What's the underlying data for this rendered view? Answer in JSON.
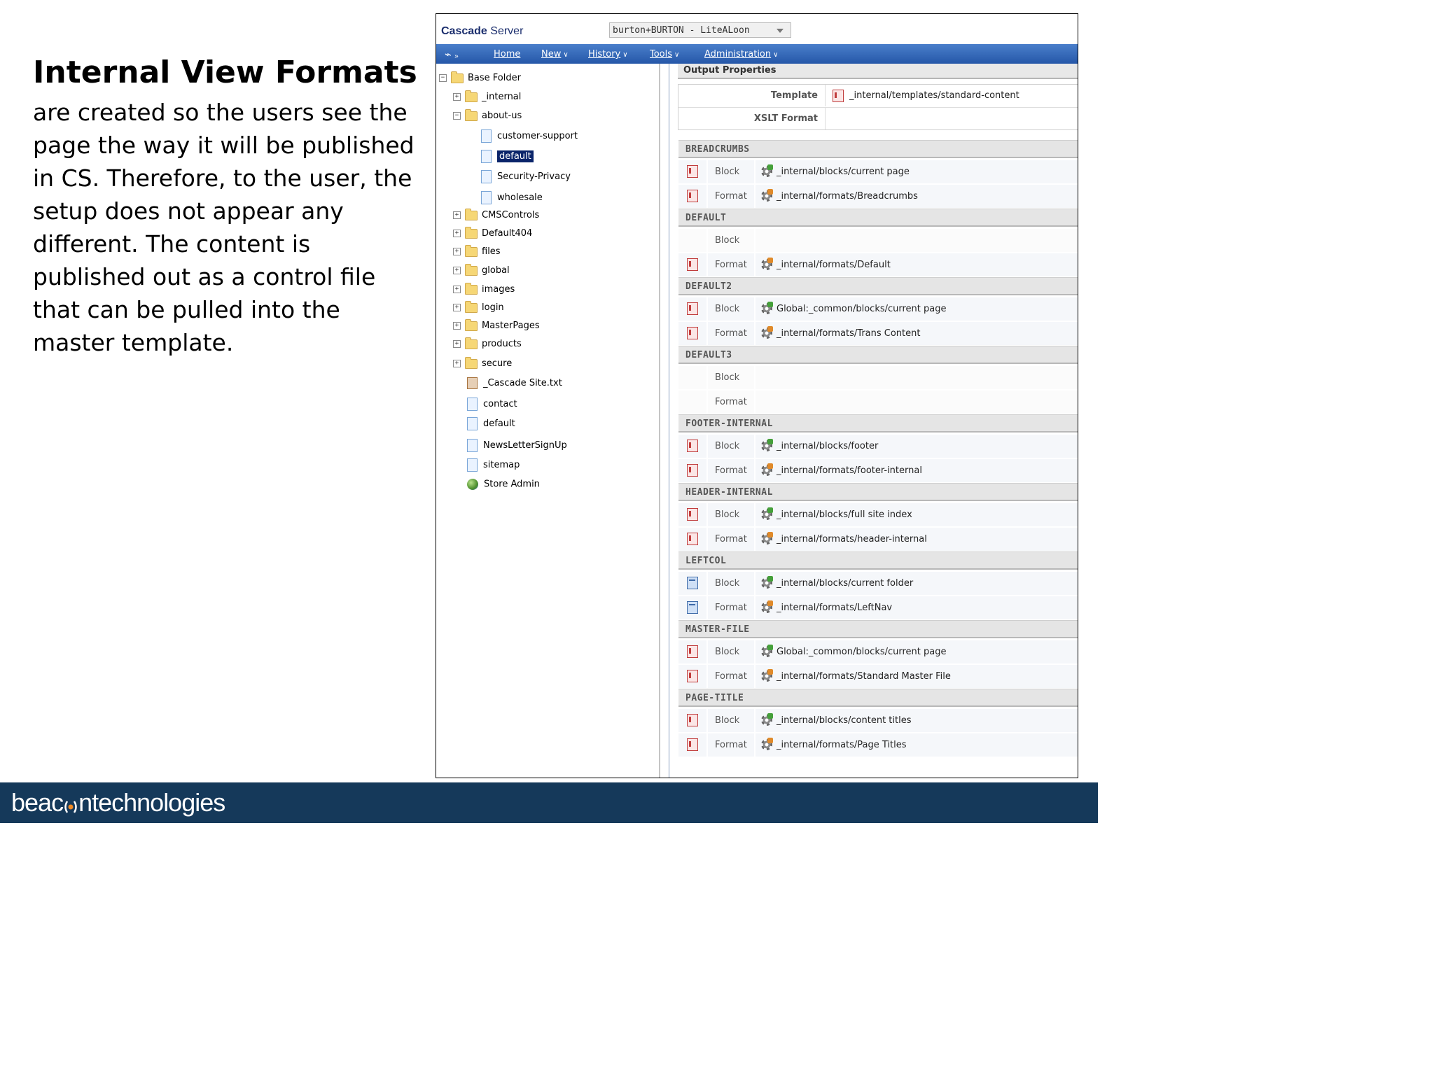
{
  "slide": {
    "title": "Internal View Formats",
    "body_lines": [
      "are created so the users see the",
      "page the way it will be published",
      "in CS.  Therefore, to the user, the",
      "setup does not appear any",
      "different.  The content is",
      "published out as a control file",
      "that can be pulled into the",
      "master template."
    ]
  },
  "footer": {
    "brand_left": "beac",
    "brand_right": "ntechnologies"
  },
  "app": {
    "logo_bold": "Cascade",
    "logo_rest": " Server",
    "site_selector": "burton+BURTON - LiteALoon",
    "menu": [
      "Home",
      "New",
      "History",
      "Tools",
      "Administration"
    ]
  },
  "tree": {
    "root": "Base Folder",
    "items": [
      {
        "label": "_internal",
        "kind": "folder",
        "toggle": "+"
      },
      {
        "label": "about-us",
        "kind": "folder",
        "toggle": "-"
      },
      {
        "label": "customer-support",
        "kind": "page"
      },
      {
        "label": "default",
        "kind": "page",
        "selected": true
      },
      {
        "label": "Security-Privacy",
        "kind": "page"
      },
      {
        "label": "wholesale",
        "kind": "page"
      },
      {
        "label": "CMSControls",
        "kind": "folder",
        "toggle": "+"
      },
      {
        "label": "Default404",
        "kind": "folder",
        "toggle": "+"
      },
      {
        "label": "files",
        "kind": "folder",
        "toggle": "+"
      },
      {
        "label": "global",
        "kind": "folder",
        "toggle": "+"
      },
      {
        "label": "images",
        "kind": "folder",
        "toggle": "+"
      },
      {
        "label": "login",
        "kind": "folder",
        "toggle": "+"
      },
      {
        "label": "MasterPages",
        "kind": "folder",
        "toggle": "+"
      },
      {
        "label": "products",
        "kind": "folder",
        "toggle": "+"
      },
      {
        "label": "secure",
        "kind": "folder",
        "toggle": "+"
      },
      {
        "label": "_Cascade Site.txt",
        "kind": "file"
      },
      {
        "label": "contact",
        "kind": "page"
      },
      {
        "label": "default",
        "kind": "page"
      },
      {
        "label": "NewsLetterSignUp",
        "kind": "page"
      },
      {
        "label": "sitemap",
        "kind": "page"
      },
      {
        "label": "Store Admin",
        "kind": "globe"
      }
    ]
  },
  "output_properties": {
    "title": "Output Properties",
    "template_label": "Template",
    "template_value": "_internal/templates/standard-content",
    "xslt_label": "XSLT Format",
    "xslt_value": ""
  },
  "regions": [
    {
      "name": "BREADCRUMBS",
      "rows": [
        {
          "type": "Block",
          "path": "_internal/blocks/current page",
          "icon": "red"
        },
        {
          "type": "Format",
          "path": "_internal/formats/Breadcrumbs",
          "icon": "red"
        }
      ]
    },
    {
      "name": "DEFAULT",
      "rows": [
        {
          "type": "Block",
          "path": "",
          "icon": ""
        },
        {
          "type": "Format",
          "path": "_internal/formats/Default",
          "icon": "red"
        }
      ]
    },
    {
      "name": "DEFAULT2",
      "rows": [
        {
          "type": "Block",
          "path": "Global:_common/blocks/current page",
          "icon": "red"
        },
        {
          "type": "Format",
          "path": "_internal/formats/Trans Content",
          "icon": "red"
        }
      ]
    },
    {
      "name": "DEFAULT3",
      "rows": [
        {
          "type": "Block",
          "path": "",
          "icon": ""
        },
        {
          "type": "Format",
          "path": "",
          "icon": ""
        }
      ]
    },
    {
      "name": "FOOTER-INTERNAL",
      "rows": [
        {
          "type": "Block",
          "path": "_internal/blocks/footer",
          "icon": "red"
        },
        {
          "type": "Format",
          "path": "_internal/formats/footer-internal",
          "icon": "red"
        }
      ]
    },
    {
      "name": "HEADER-INTERNAL",
      "rows": [
        {
          "type": "Block",
          "path": "_internal/blocks/full site index",
          "icon": "red"
        },
        {
          "type": "Format",
          "path": "_internal/formats/header-internal",
          "icon": "red"
        }
      ]
    },
    {
      "name": "LEFTCOL",
      "rows": [
        {
          "type": "Block",
          "path": "_internal/blocks/current folder",
          "icon": "blue"
        },
        {
          "type": "Format",
          "path": "_internal/formats/LeftNav",
          "icon": "blue"
        }
      ]
    },
    {
      "name": "MASTER-FILE",
      "rows": [
        {
          "type": "Block",
          "path": "Global:_common/blocks/current page",
          "icon": "red"
        },
        {
          "type": "Format",
          "path": "_internal/formats/Standard Master File",
          "icon": "red"
        }
      ]
    },
    {
      "name": "PAGE-TITLE",
      "rows": [
        {
          "type": "Block",
          "path": "_internal/blocks/content titles",
          "icon": "red"
        },
        {
          "type": "Format",
          "path": "_internal/formats/Page Titles",
          "icon": "red"
        }
      ]
    }
  ],
  "colors": {
    "footer_bg": "#15395a",
    "menubar": "#2f64b4",
    "selected": "#0a246a"
  }
}
